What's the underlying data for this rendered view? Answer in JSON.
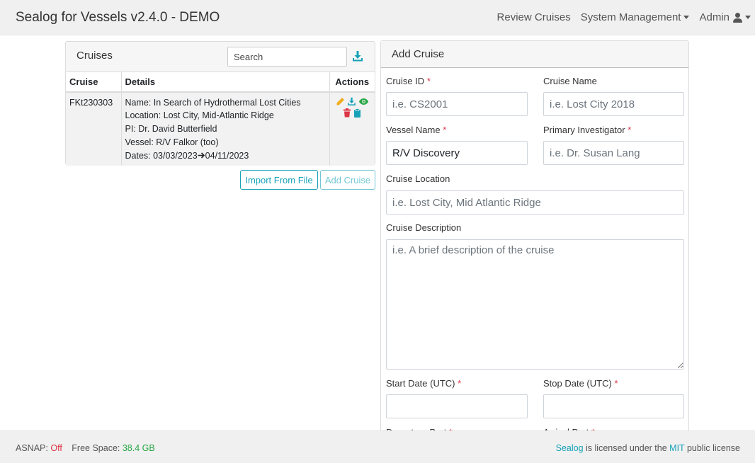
{
  "navbar": {
    "brand": "Sealog for Vessels v2.4.0 - DEMO",
    "review_cruises": "Review Cruises",
    "system_management": "System Management",
    "admin": "Admin"
  },
  "cruises_panel": {
    "title": "Cruises",
    "search_placeholder": "Search",
    "columns": [
      "Cruise",
      "Details",
      "Actions"
    ],
    "rows": [
      {
        "cruise_id": "FKt230303",
        "details": {
          "name": "Name: In Search of Hydrothermal Lost Cities",
          "location": "Location: Lost City, Mid-Atlantic Ridge",
          "pi": "PI: Dr. David Butterfield",
          "vessel": "Vessel: R/V Falkor (too)",
          "dates_start": "Dates: 03/03/2023",
          "dates_end": "04/11/2023"
        }
      }
    ],
    "import_button": "Import From File",
    "add_button": "Add Cruise"
  },
  "add_cruise_form": {
    "title": "Add Cruise",
    "cruise_id": {
      "label": "Cruise ID",
      "placeholder": "i.e. CS2001",
      "value": ""
    },
    "cruise_name": {
      "label": "Cruise Name",
      "placeholder": "i.e. Lost City 2018",
      "value": ""
    },
    "vessel_name": {
      "label": "Vessel Name",
      "placeholder": "",
      "value": "R/V Discovery"
    },
    "primary_investigator": {
      "label": "Primary Investigator",
      "placeholder": "i.e. Dr. Susan Lang",
      "value": ""
    },
    "cruise_location": {
      "label": "Cruise Location",
      "placeholder": "i.e. Lost City, Mid Atlantic Ridge",
      "value": ""
    },
    "cruise_description": {
      "label": "Cruise Description",
      "placeholder": "i.e. A brief description of the cruise",
      "value": ""
    },
    "start_date": {
      "label": "Start Date (UTC)",
      "value": ""
    },
    "stop_date": {
      "label": "Stop Date (UTC)",
      "value": ""
    },
    "departure_port_label": "Departure Port",
    "arrival_port_label": "Arrival Port",
    "required_marker": "*"
  },
  "footer": {
    "asnap_label": "ASNAP:",
    "asnap_value": "Off",
    "free_space_label": "Free Space:",
    "free_space_value": "38.4 GB",
    "sealog_link": "Sealog",
    "license_text_1": "is licensed under the",
    "mit_link": "MIT",
    "license_text_2": "public license"
  },
  "colors": {
    "accent": "#17a2b8",
    "required": "#dc3545",
    "edit_icon": "#f0ad1e",
    "delete_icon": "#dc3545",
    "view_icon": "#28a745",
    "download_icon": "#17a2b8"
  },
  "icons": [
    "user-icon",
    "download-icon",
    "pencil-icon",
    "trash-icon",
    "eye-icon",
    "clipboard-icon",
    "arrow-right-icon"
  ]
}
